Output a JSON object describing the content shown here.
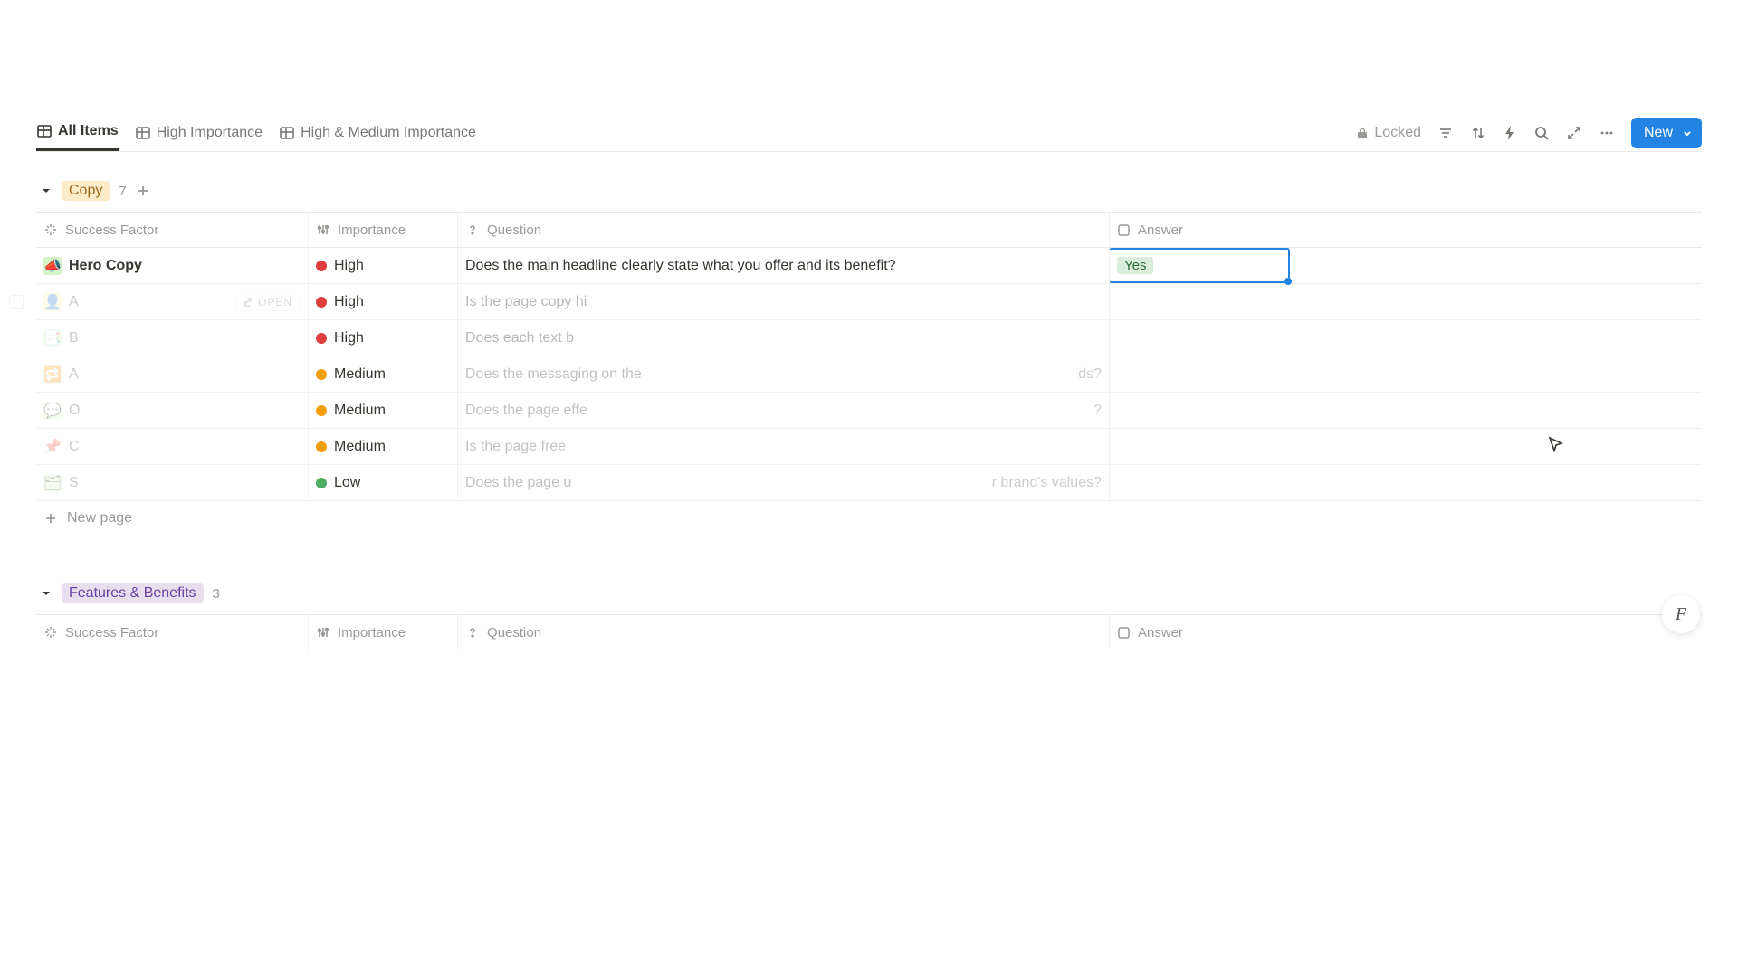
{
  "tabs": [
    {
      "label": "All Items",
      "active": true
    },
    {
      "label": "High Importance",
      "active": false
    },
    {
      "label": "High & Medium Importance",
      "active": false
    }
  ],
  "locked": "Locked",
  "newButton": "New",
  "columns": {
    "successFactor": "Success Factor",
    "importance": "Importance",
    "question": "Question",
    "answer": "Answer"
  },
  "groups": [
    {
      "name": "Copy",
      "badgeClass": "badge-yellow",
      "count": "7",
      "rows": [
        {
          "icon": "📣",
          "iconBg": "#d6f5c6",
          "sf": "Hero Copy",
          "sfBold": true,
          "importance": "High",
          "dot": "dot-red",
          "question": "Does the main headline clearly state what you offer and its benefit?",
          "answer": "Yes",
          "answerSelected": true
        },
        {
          "icon": "👤",
          "iconBg": "#fff3b0",
          "sf": "A",
          "importance": "High",
          "dot": "dot-red",
          "question": "Is the page copy hi",
          "showOpen": true,
          "showCheck": true,
          "faded": true
        },
        {
          "icon": "📑",
          "iconBg": "#d6f5c6",
          "sf": "B",
          "importance": "High",
          "dot": "dot-red",
          "question": "Does each text b",
          "faded": true
        },
        {
          "icon": "🔁",
          "iconBg": "#d6f5c6",
          "sf": "A",
          "importance": "Medium",
          "dot": "dot-orange",
          "question": "Does the messaging on the",
          "questionTail": "ds?",
          "faded": true
        },
        {
          "icon": "💬",
          "iconBg": "#d6f5c6",
          "sf": "O",
          "importance": "Medium",
          "dot": "dot-orange",
          "question": "Does the page effe",
          "questionTail": "?",
          "faded": true
        },
        {
          "icon": "📌",
          "iconBg": "",
          "sf": "C",
          "importance": "Medium",
          "dot": "dot-orange",
          "question": "Is the page free",
          "faded": true
        },
        {
          "icon": "🗂",
          "iconBg": "#d6f5c6",
          "sf": "S",
          "importance": "Low",
          "dot": "dot-green",
          "question": "Does the page u",
          "questionTail": "r brand's values?",
          "faded": true
        }
      ]
    },
    {
      "name": "Features & Benefits",
      "badgeClass": "badge-purple",
      "count": "3",
      "rows": []
    }
  ],
  "newPage": "New page",
  "openLabel": "OPEN"
}
